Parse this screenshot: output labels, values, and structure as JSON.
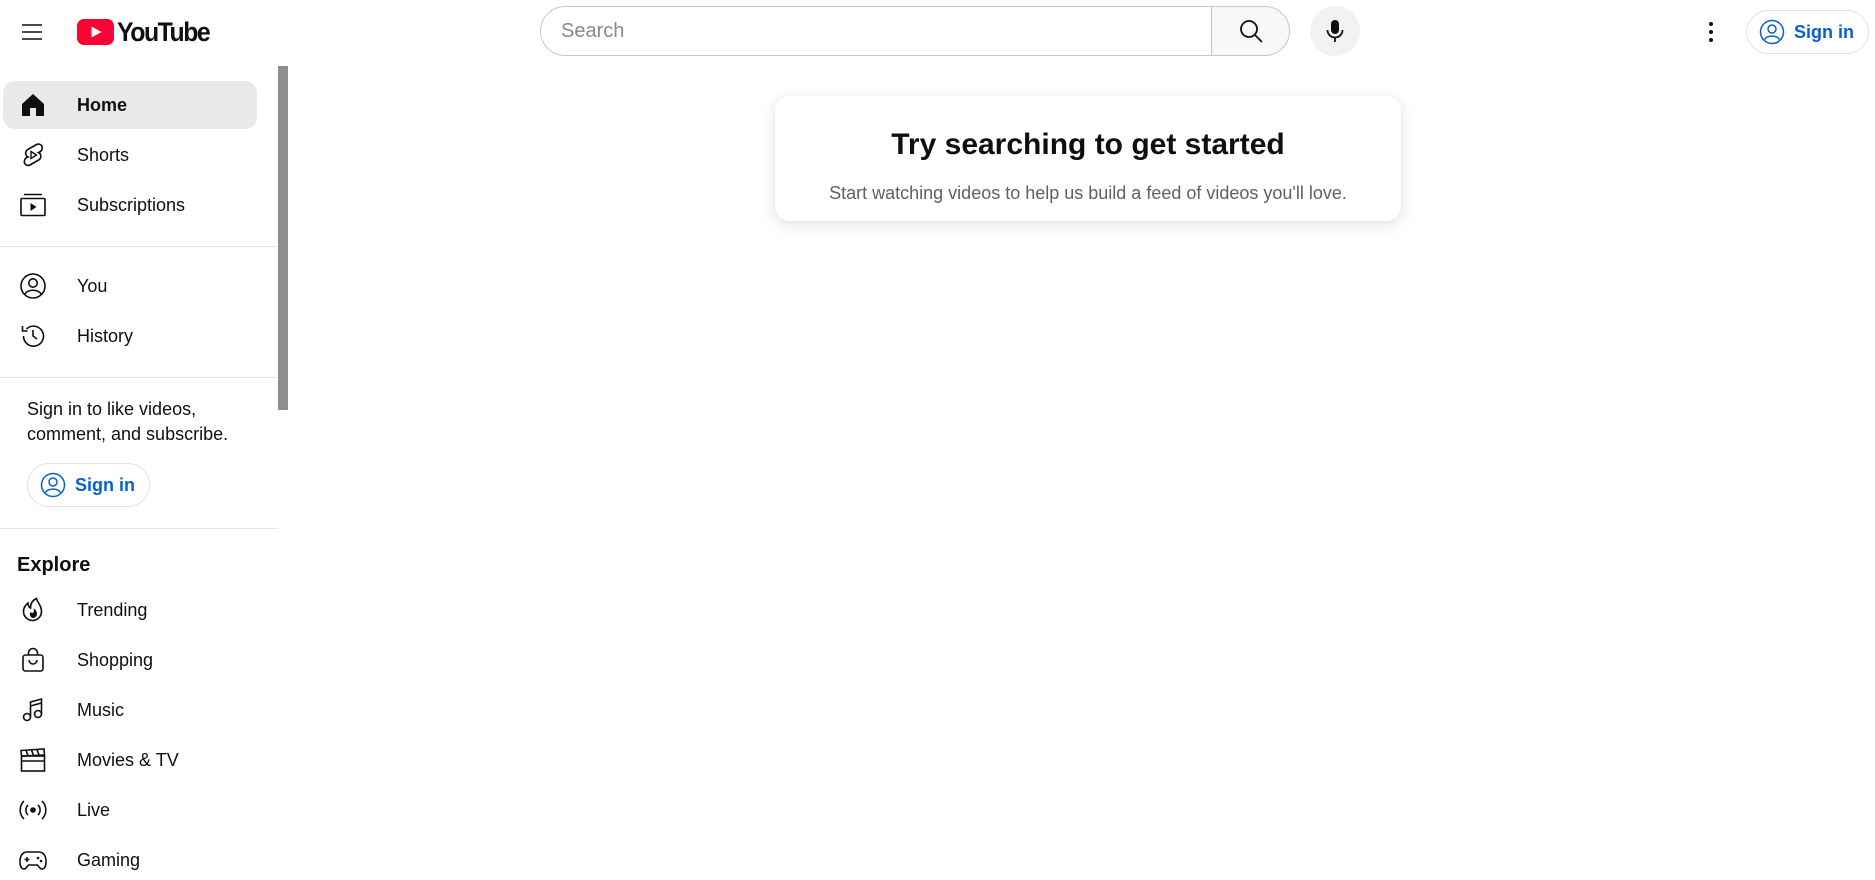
{
  "header": {
    "logo_text": "YouTube",
    "search_placeholder": "Search",
    "search_value": "",
    "signin_label": "Sign in"
  },
  "sidebar": {
    "primary": [
      {
        "label": "Home",
        "icon": "home-icon",
        "active": true
      },
      {
        "label": "Shorts",
        "icon": "shorts-icon"
      },
      {
        "label": "Subscriptions",
        "icon": "subscriptions-icon"
      }
    ],
    "you": [
      {
        "label": "You",
        "icon": "account-circle-icon"
      },
      {
        "label": "History",
        "icon": "history-icon"
      }
    ],
    "signin_prompt": "Sign in to like videos, comment, and subscribe.",
    "signin_label": "Sign in",
    "explore_title": "Explore",
    "explore": [
      {
        "label": "Trending",
        "icon": "trending-icon"
      },
      {
        "label": "Shopping",
        "icon": "shopping-bag-icon"
      },
      {
        "label": "Music",
        "icon": "music-note-icon"
      },
      {
        "label": "Movies & TV",
        "icon": "clapperboard-icon"
      },
      {
        "label": "Live",
        "icon": "live-icon"
      },
      {
        "label": "Gaming",
        "icon": "gaming-controller-icon"
      }
    ]
  },
  "main": {
    "empty_title": "Try searching to get started",
    "empty_subtitle": "Start watching videos to help us build a feed of videos you'll love."
  },
  "colors": {
    "brand_red": "#ff0033",
    "link_blue": "#065fd4",
    "active_bg": "#e9e9e9"
  }
}
